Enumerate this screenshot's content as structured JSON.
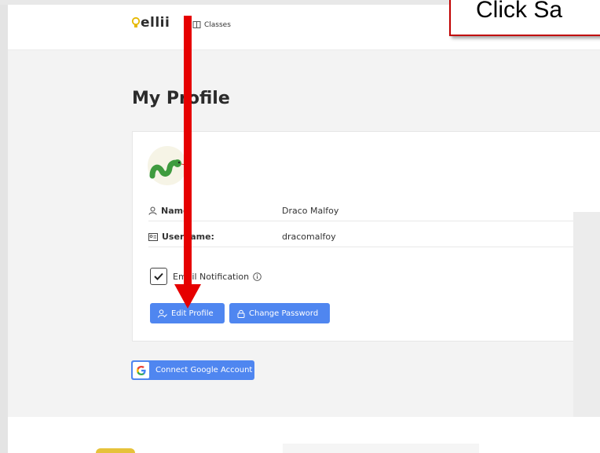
{
  "nav": {
    "logo_text": "ellii",
    "classes_label": "Classes"
  },
  "callout": {
    "text": "Click Sa"
  },
  "profile": {
    "title": "My Profile",
    "name_label": "Name:",
    "name_value": "Draco Malfoy",
    "username_label": "Username:",
    "username_value": "dracomalfoy",
    "email_notification_label": "Email Notification",
    "email_notification_checked": true,
    "edit_profile_label": "Edit Profile",
    "change_password_label": "Change Password"
  },
  "google": {
    "connect_label": "Connect Google Account"
  },
  "colors": {
    "primary_button": "#4f86f0",
    "annotation_arrow": "#e60000",
    "callout_border": "#c00000"
  }
}
